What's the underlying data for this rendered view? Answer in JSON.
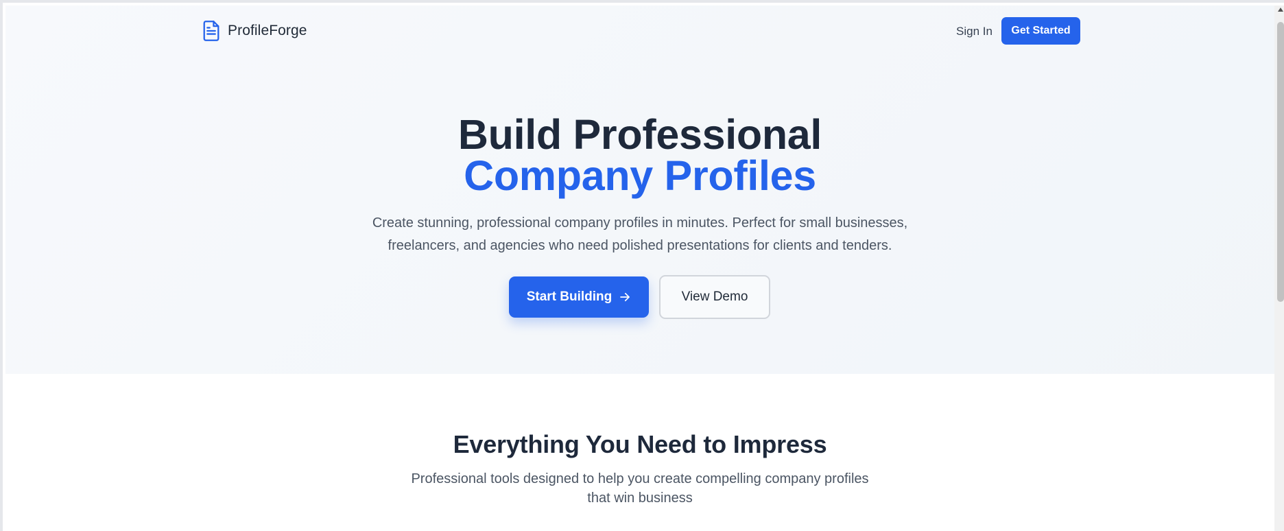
{
  "header": {
    "brand_name": "ProfileForge",
    "sign_in_label": "Sign In",
    "get_started_label": "Get Started"
  },
  "hero": {
    "title_line1": "Build Professional",
    "title_line2": "Company Profiles",
    "subtitle_line1": "Create stunning, professional company profiles in minutes. Perfect for small businesses,",
    "subtitle_line2": "freelancers, and agencies who need polished presentations for clients and tenders.",
    "start_building_label": "Start Building",
    "view_demo_label": "View Demo"
  },
  "features": {
    "heading": "Everything You Need to Impress",
    "subtitle_line1": "Professional tools designed to help you create compelling company profiles",
    "subtitle_line2": "that win business"
  },
  "colors": {
    "accent": "#2563eb",
    "heading": "#1e293b",
    "body_text": "#4b5563",
    "hero_background": "#f4f7fb"
  },
  "icons": {
    "brand": "document-icon",
    "start_building": "arrow-right-icon",
    "scroll_up": "triangle-up-icon"
  }
}
